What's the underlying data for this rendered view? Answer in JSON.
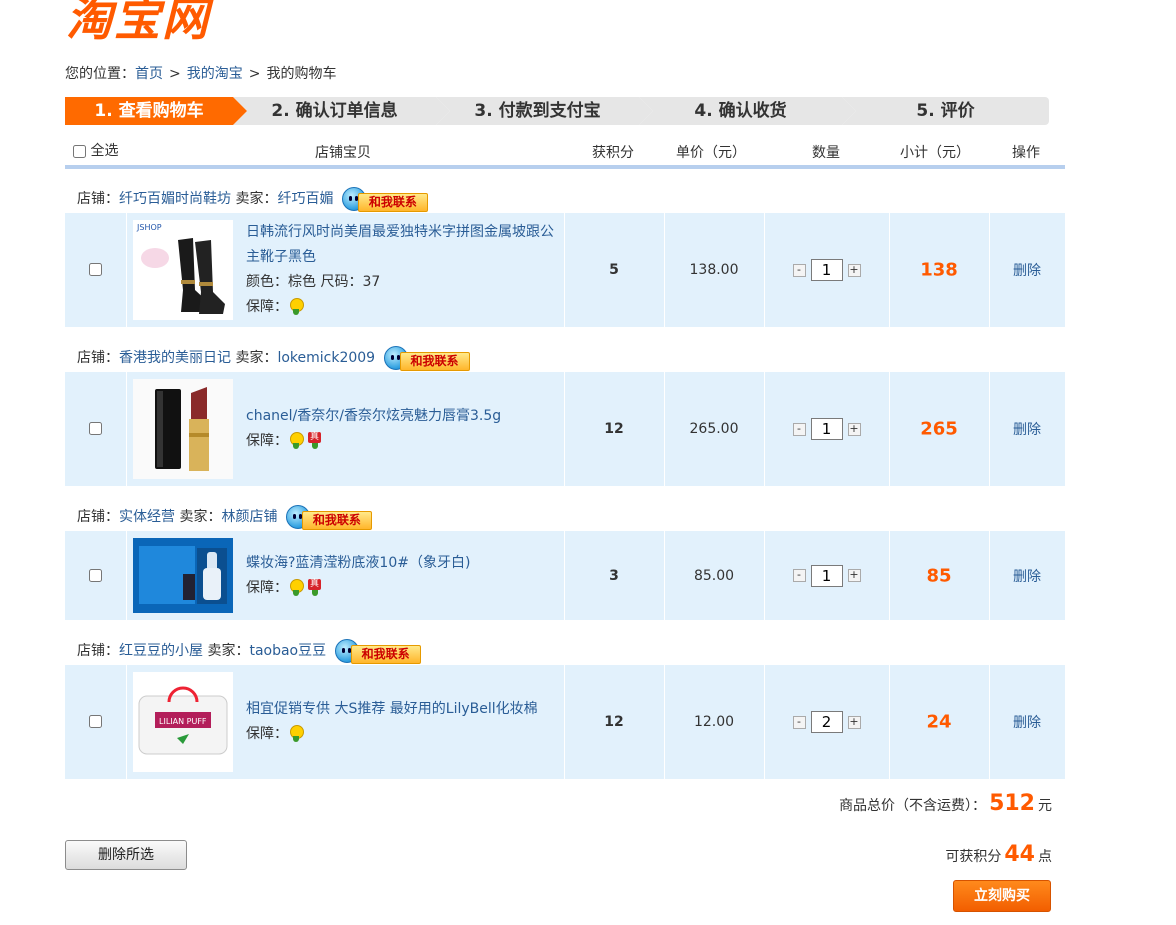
{
  "logo": {
    "text": "淘宝网"
  },
  "breadcrumb": {
    "prefix": "您的位置：",
    "items": [
      "首页",
      "我的淘宝",
      "我的购物车"
    ],
    "sep": ">"
  },
  "steps": [
    "1. 查看购物车",
    "2. 确认订单信息",
    "3. 付款到支付宝",
    "4. 确认收货",
    "5. 评价"
  ],
  "active_step": 0,
  "table_header": {
    "select_all": "全选",
    "item": "店铺宝贝",
    "points": "获积分",
    "price": "单价（元）",
    "qty": "数量",
    "subtotal": "小计（元）",
    "op": "操作"
  },
  "labels": {
    "shop": "店铺：",
    "seller": "卖家：",
    "contact": "和我联系",
    "guarantee": "保障：",
    "delete": "删除"
  },
  "orders": [
    {
      "shop": "纤巧百媚时尚鞋坊",
      "seller": "纤巧百媚",
      "title": "日韩流行风时尚美眉最爱独特米字拼图金属坡跟公主靴子黑色",
      "attrs": "颜色：棕色 尺码：37",
      "guarantee": [
        "y"
      ],
      "points": "5",
      "price": "138.00",
      "qty": "1",
      "subtotal": "138",
      "thumb_label": "JSHOP"
    },
    {
      "shop": "香港我的美丽日记",
      "seller": "lokemick2009",
      "title": "chanel/香奈尔/香奈尔炫亮魅力唇膏3.5g",
      "attrs": "",
      "guarantee": [
        "y",
        "r"
      ],
      "points": "12",
      "price": "265.00",
      "qty": "1",
      "subtotal": "265",
      "thumb_label": ""
    },
    {
      "shop": "实体经营",
      "seller": "林颜店铺",
      "title": "蝶妆海?蓝清滢粉底液10#（象牙白)",
      "attrs": "",
      "guarantee": [
        "y",
        "r"
      ],
      "points": "3",
      "price": "85.00",
      "qty": "1",
      "subtotal": "85",
      "thumb_label": ""
    },
    {
      "shop": "红豆豆的小屋",
      "seller": "taobao豆豆",
      "title": "相宜促销专供 大S推荐 最好用的LilyBell化妆棉",
      "attrs": "",
      "guarantee": [
        "y"
      ],
      "points": "12",
      "price": "12.00",
      "qty": "2",
      "subtotal": "24",
      "thumb_label": "LILIAN PUFF"
    }
  ],
  "summary": {
    "total_label": "商品总价（不含运费）：",
    "total_value": "512",
    "total_unit": "元",
    "points_label": "可获积分",
    "points_value": "44",
    "points_unit": "点"
  },
  "actions": {
    "delete_selected": "删除所选",
    "buy_now": "立刻购买"
  },
  "colors": {
    "accent": "#ff5a00",
    "row_bg": "#e2f1fc",
    "link": "#2a5d96"
  }
}
